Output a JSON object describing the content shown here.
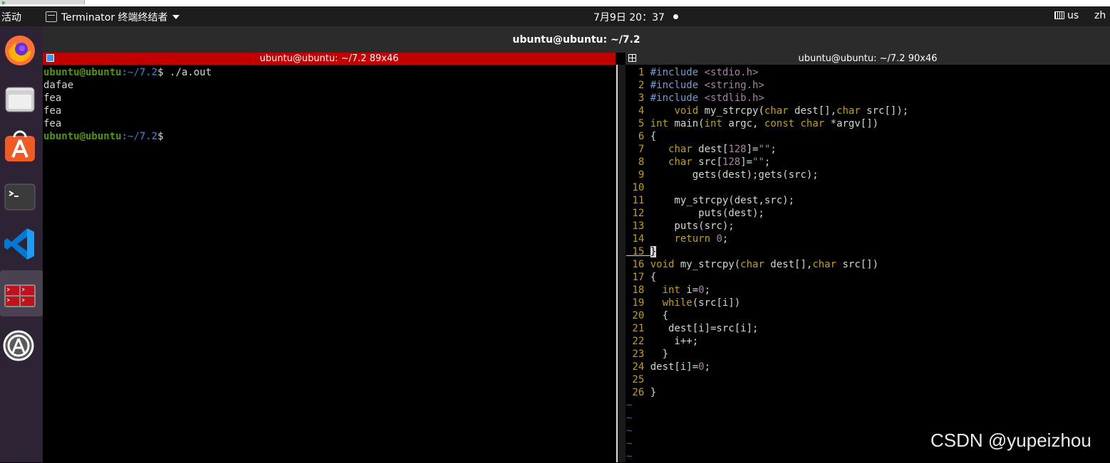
{
  "topbar": {
    "activities": "活动",
    "app_menu_label": "Terminator 终端终结者",
    "clock": "7月9日  20：37",
    "input_source": "us",
    "language": "zh"
  },
  "dock": {
    "items": [
      "firefox-icon",
      "files-icon",
      "ubuntu-software-icon",
      "terminal-icon",
      "vscode-icon",
      "terminator-icon",
      "software-updater-icon"
    ],
    "active_index": 5
  },
  "window": {
    "title": "ubuntu@ubuntu: ~/7.2"
  },
  "left_pane": {
    "title": "ubuntu@ubuntu: ~/7.2 89x46",
    "prompt_user": "ubuntu@ubuntu",
    "prompt_path": ":~/7.2",
    "prompt_suffix": "$ ",
    "command": "./a.out",
    "output_lines": [
      "dafae",
      "fea",
      "fea",
      "fea"
    ],
    "final_prompt_suffix": "$"
  },
  "right_pane": {
    "title": "ubuntu@ubuntu: ~/7.2 90x46",
    "cursor_line": 15,
    "code": [
      {
        "n": "1",
        "t": "#include <stdio.h>"
      },
      {
        "n": "2",
        "t": "#include <string.h>"
      },
      {
        "n": "3",
        "t": "#include <stdlib.h>"
      },
      {
        "n": "4",
        "t": "    void my_strcpy(char dest[],char src[]);"
      },
      {
        "n": "5",
        "t": "int main(int argc, const char *argv[])"
      },
      {
        "n": "6",
        "t": "{"
      },
      {
        "n": "7",
        "t": "   char dest[128]=\"\";"
      },
      {
        "n": "8",
        "t": "   char src[128]=\"\";"
      },
      {
        "n": "9",
        "t": "       gets(dest);gets(src);"
      },
      {
        "n": "10",
        "t": ""
      },
      {
        "n": "11",
        "t": "    my_strcpy(dest,src);"
      },
      {
        "n": "12",
        "t": "        puts(dest);"
      },
      {
        "n": "13",
        "t": "    puts(src);"
      },
      {
        "n": "14",
        "t": "    return 0;"
      },
      {
        "n": "15",
        "t": "}"
      },
      {
        "n": "16",
        "t": "void my_strcpy(char dest[],char src[])"
      },
      {
        "n": "17",
        "t": "{"
      },
      {
        "n": "18",
        "t": "  int i=0;"
      },
      {
        "n": "19",
        "t": "  while(src[i])"
      },
      {
        "n": "20",
        "t": "  {"
      },
      {
        "n": "21",
        "t": "   dest[i]=src[i];"
      },
      {
        "n": "22",
        "t": "    i++;"
      },
      {
        "n": "23",
        "t": "  }"
      },
      {
        "n": "24",
        "t": "dest[i]=0;"
      },
      {
        "n": "25",
        "t": ""
      },
      {
        "n": "26",
        "t": "}"
      }
    ],
    "tilde_lines": 5
  },
  "watermark": "CSDN @yupeizhou"
}
